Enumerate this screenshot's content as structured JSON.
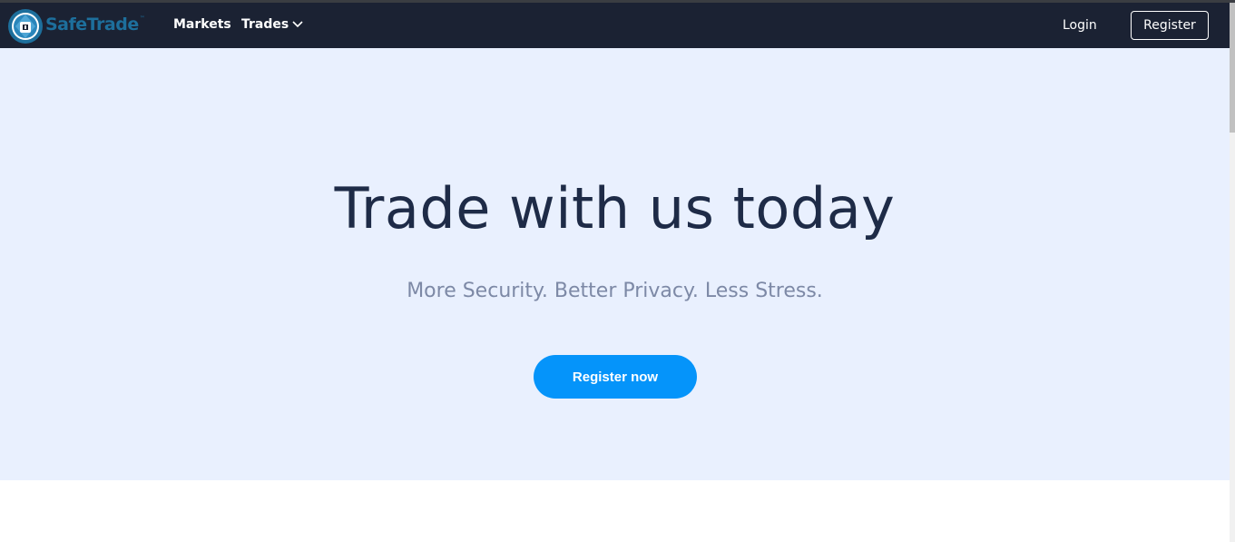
{
  "brand": {
    "name": "SafeTrade",
    "trademark": "™",
    "logo_icon": "shield-lock-logo-icon"
  },
  "nav": {
    "markets": "Markets",
    "trades": "Trades",
    "trades_icon": "chevron-down-icon",
    "login": "Login",
    "register": "Register"
  },
  "hero": {
    "title": "Trade with us today",
    "subtitle": "More Security. Better Privacy. Less Stress.",
    "cta": "Register now"
  },
  "colors": {
    "navbar_bg": "#1b2233",
    "hero_bg": "#e9f0fe",
    "accent": "#0594fa",
    "title": "#1e2b47",
    "subtitle": "#7d89a6"
  }
}
